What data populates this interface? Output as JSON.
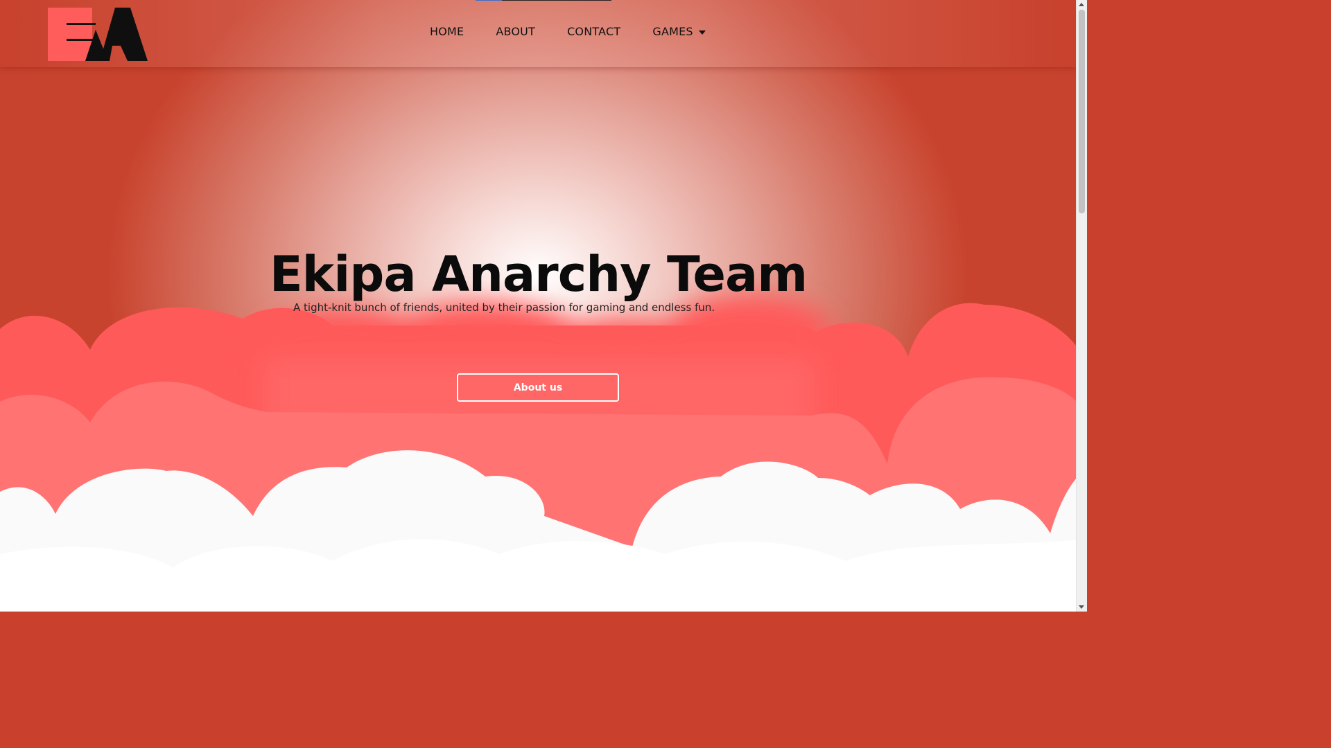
{
  "brand": {
    "logo_text": "EA",
    "name": "Ekipa Anarchy"
  },
  "nav": {
    "items": [
      {
        "label": "HOME"
      },
      {
        "label": "ABOUT"
      },
      {
        "label": "CONTACT"
      },
      {
        "label": "GAMES",
        "has_dropdown": true
      }
    ]
  },
  "hero": {
    "title": "Ekipa Anarchy Team",
    "subtitle": "A tight-knit bunch of friends, united by their passion for gaming and endless fun.",
    "button_label": "About us"
  },
  "colors": {
    "primary_red": "#ff5a5a",
    "mid_red": "#ff7070",
    "cloud_white": "#fafafa",
    "text_dark": "#0b0b0b"
  },
  "icons": {
    "dropdown": "caret-down-icon"
  }
}
